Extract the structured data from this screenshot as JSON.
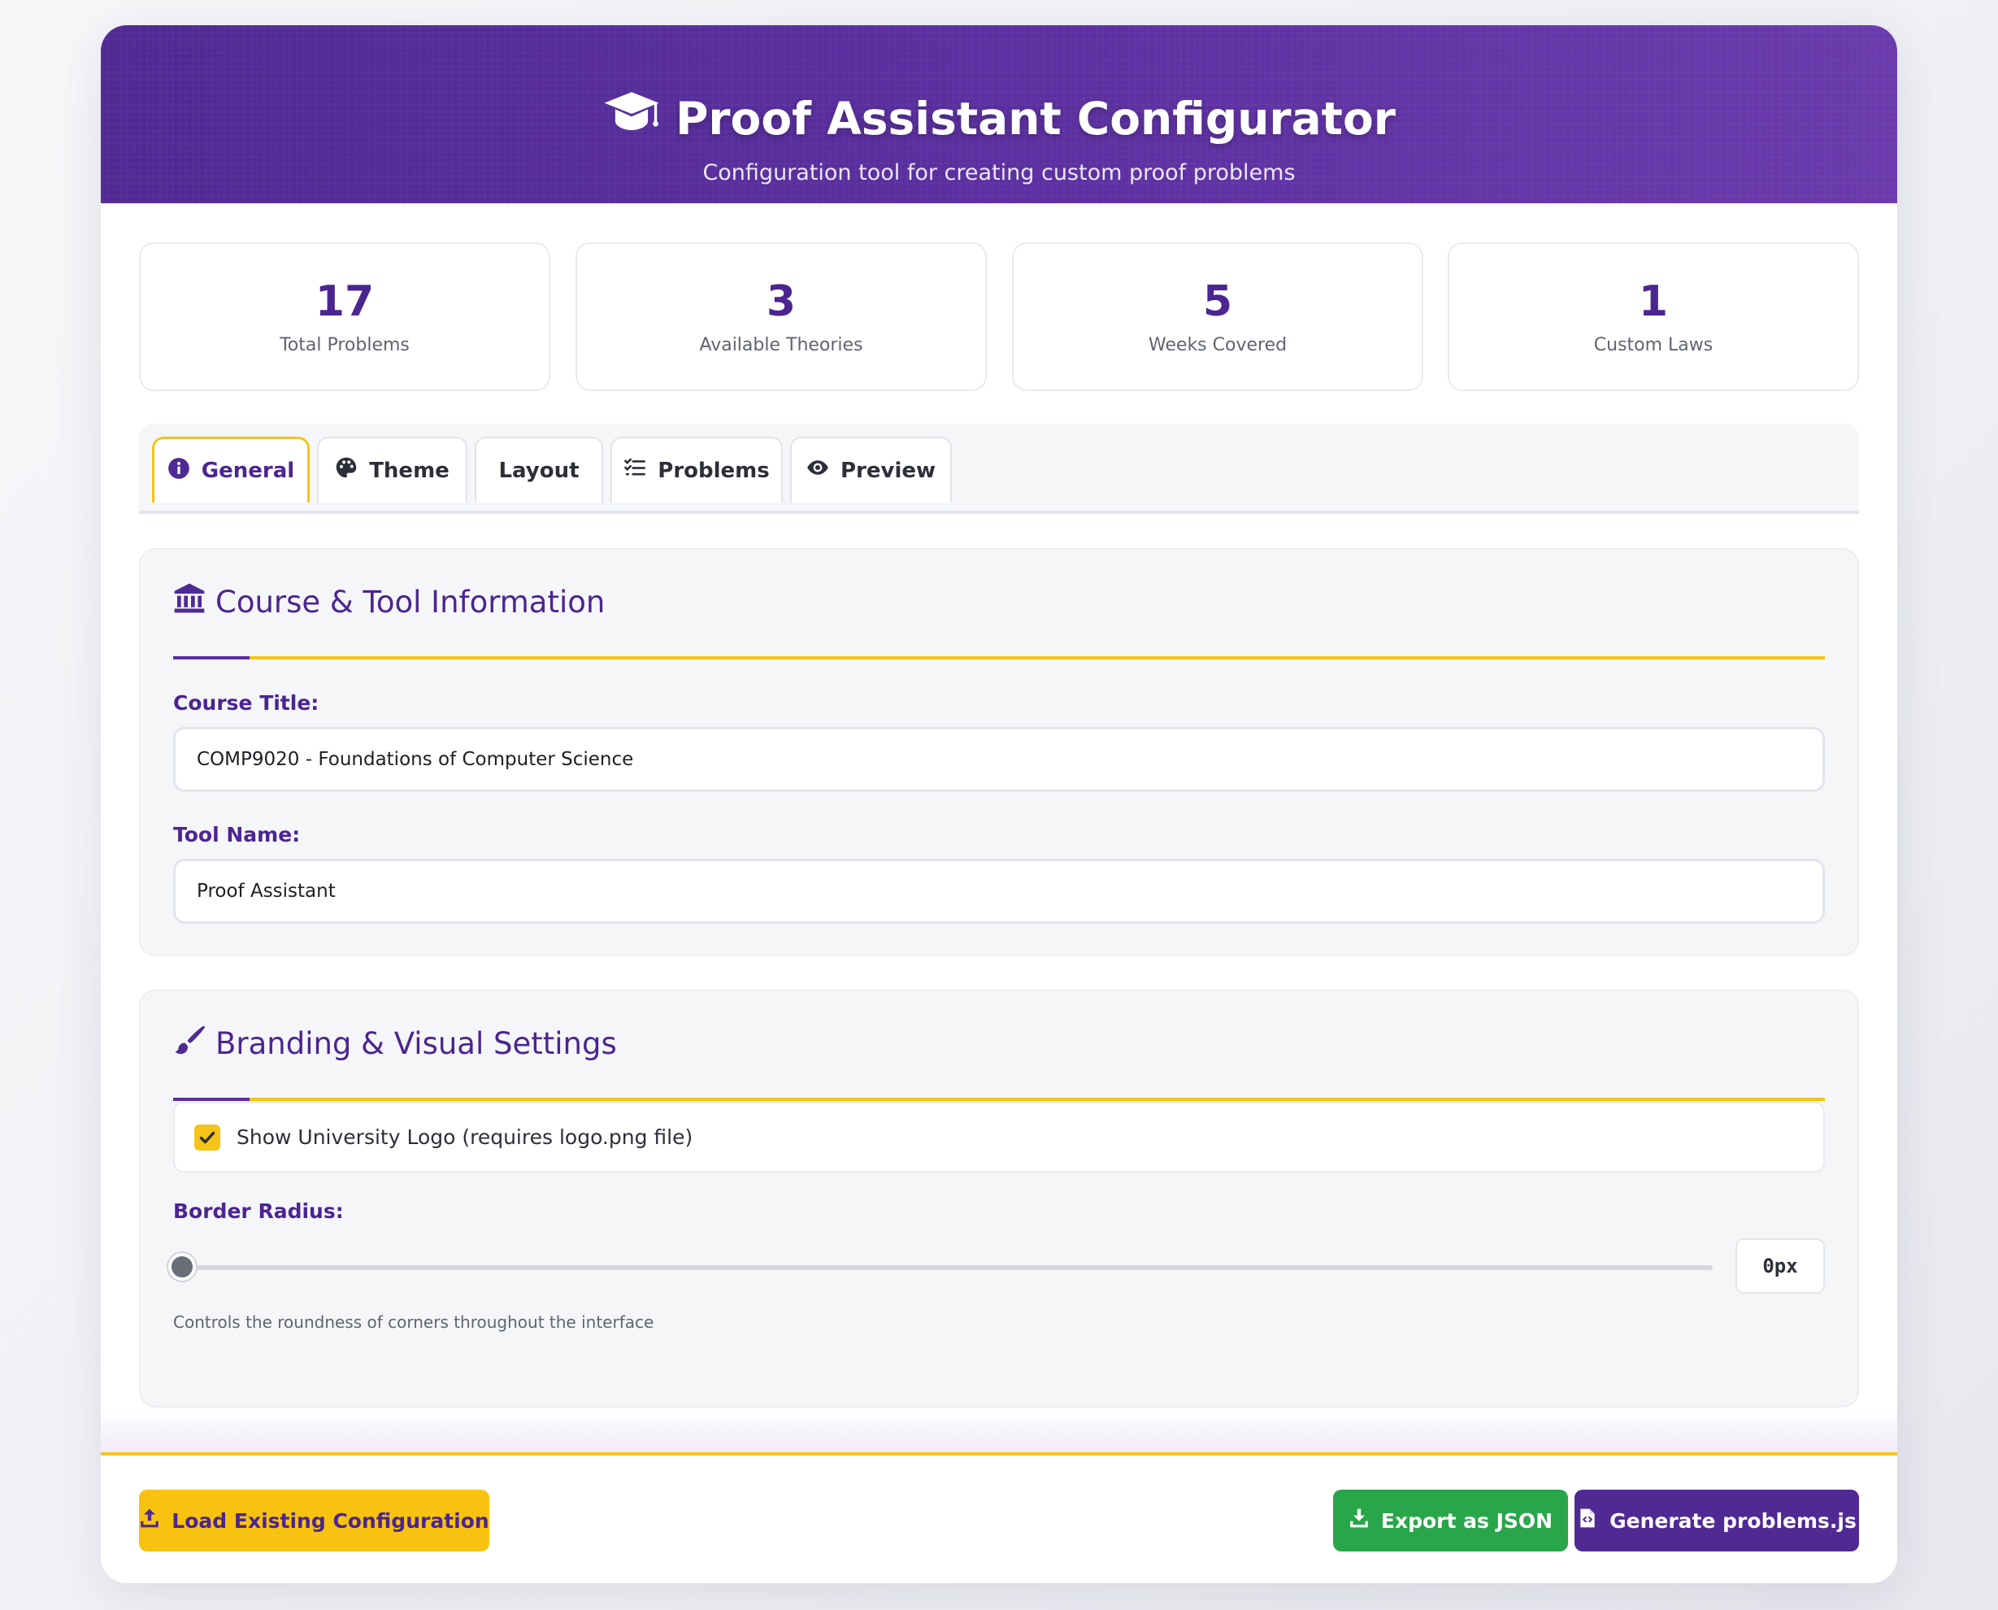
{
  "header": {
    "title": "Proof Assistant Configurator",
    "subtitle": "Configuration tool for creating custom proof problems",
    "icon": "graduation-cap-icon"
  },
  "stats": [
    {
      "value": "17",
      "label": "Total Problems"
    },
    {
      "value": "3",
      "label": "Available Theories"
    },
    {
      "value": "5",
      "label": "Weeks Covered"
    },
    {
      "value": "1",
      "label": "Custom Laws"
    }
  ],
  "tabs": [
    {
      "label": "General",
      "icon": "info-circle-icon",
      "active": true
    },
    {
      "label": "Theme",
      "icon": "palette-icon",
      "active": false
    },
    {
      "label": "Layout",
      "icon": "",
      "active": false
    },
    {
      "label": "Problems",
      "icon": "checklist-icon",
      "active": false
    },
    {
      "label": "Preview",
      "icon": "eye-icon",
      "active": false
    }
  ],
  "course_section": {
    "title": "Course & Tool Information",
    "icon": "university-icon",
    "course_title_label": "Course Title:",
    "course_title_value": "COMP9020 - Foundations of Computer Science",
    "tool_name_label": "Tool Name:",
    "tool_name_value": "Proof Assistant"
  },
  "branding_section": {
    "title": "Branding & Visual Settings",
    "icon": "paint-brush-icon",
    "show_logo_label": "Show University Logo (requires logo.png file)",
    "show_logo_checked": true,
    "border_radius_label": "Border Radius:",
    "border_radius_value": 0,
    "border_radius_display": "0px",
    "border_radius_hint": "Controls the roundness of corners throughout the interface"
  },
  "footer": {
    "load_label": "Load Existing Configuration",
    "export_label": "Export as JSON",
    "generate_label": "Generate problems.js"
  },
  "colors": {
    "primary": "#4f2a93",
    "accent": "#f4c417",
    "success": "#29a64a"
  }
}
